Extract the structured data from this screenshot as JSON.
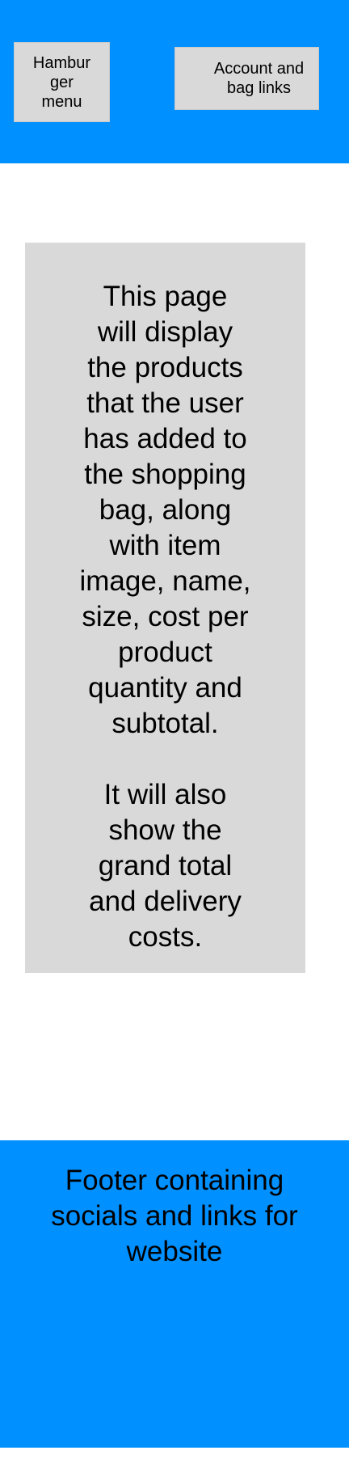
{
  "header": {
    "hamburger_label": "Hambur\nger\nmenu",
    "account_label": "Account and bag links"
  },
  "main": {
    "paragraph_1": "This page\nwill display\nthe products\nthat the user\nhas added to\nthe shopping\nbag, along\nwith item\nimage, name,\nsize, cost per\nproduct\nquantity and\nsubtotal.",
    "paragraph_2": "It will also\nshow the\ngrand total\nand delivery\ncosts."
  },
  "footer": {
    "label": "Footer containing\nsocials and links for\nwebsite"
  },
  "colors": {
    "header_background": "#0090ff",
    "footer_background": "#0090ff",
    "placeholder_box": "#d9d9d9",
    "page_background": "#ffffff"
  }
}
